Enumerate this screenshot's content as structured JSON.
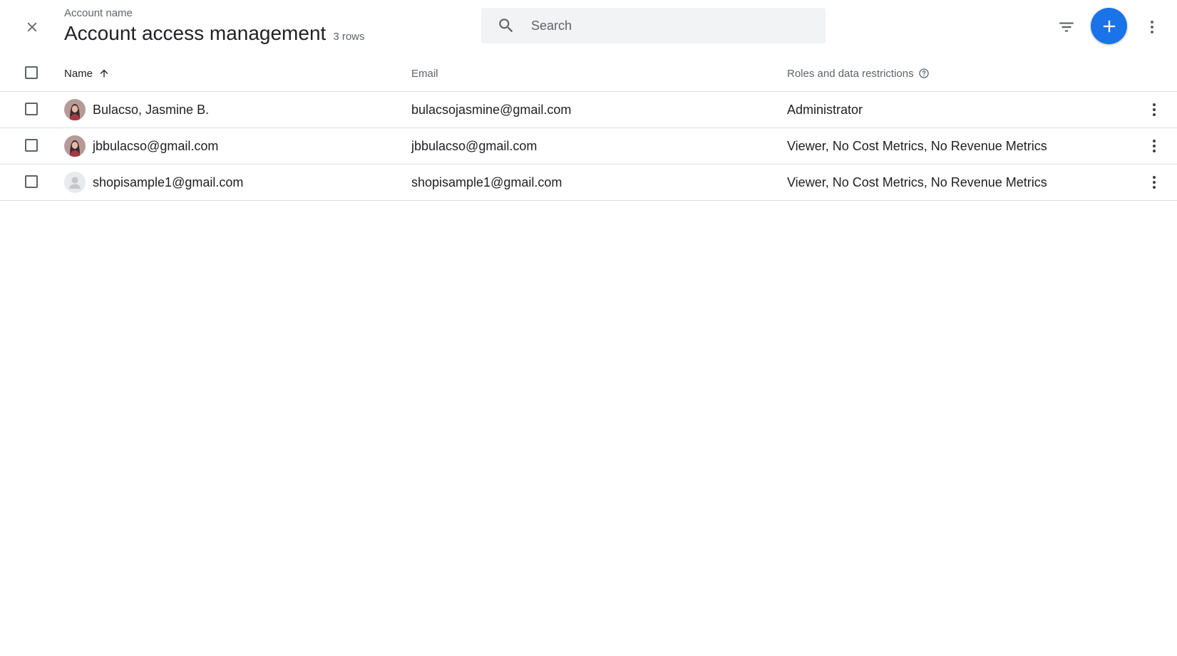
{
  "header": {
    "account_label": "Account name",
    "title": "Account access management",
    "row_count": "3 rows"
  },
  "search": {
    "placeholder": "Search"
  },
  "icons": {
    "close": "close-icon",
    "search": "search-icon",
    "filter": "filter-icon",
    "add": "plus-icon",
    "more": "more-vert-icon",
    "sort": "arrow-up-icon",
    "help": "help-circle-icon"
  },
  "colors": {
    "accent": "#1a73e8",
    "search_bg": "#f1f3f4"
  },
  "table": {
    "columns": {
      "name": "Name",
      "email": "Email",
      "roles": "Roles and data restrictions"
    },
    "rows": [
      {
        "name": "Bulacso, Jasmine B.",
        "email": "bulacsojasmine@gmail.com",
        "roles": "Administrator",
        "avatar": "photo"
      },
      {
        "name": "jbbulacso@gmail.com",
        "email": "jbbulacso@gmail.com",
        "roles": "Viewer, No Cost Metrics, No Revenue Metrics",
        "avatar": "photo"
      },
      {
        "name": "shopisample1@gmail.com",
        "email": "shopisample1@gmail.com",
        "roles": "Viewer, No Cost Metrics, No Revenue Metrics",
        "avatar": "placeholder"
      }
    ]
  }
}
